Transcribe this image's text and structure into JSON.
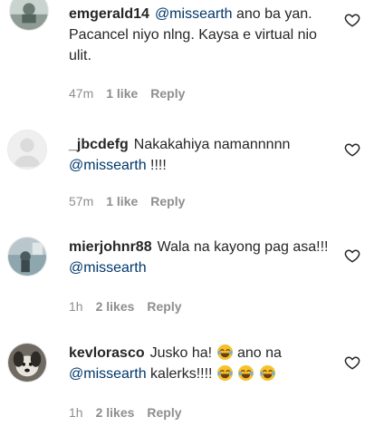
{
  "comments": [
    {
      "username": "emgerald14",
      "mention": "@missearth",
      "text_after": " ano ba yan. Pacancel niyo nlng. Kaysa e virtual nio ulit.",
      "time": "47m",
      "likes": "1 like",
      "reply": "Reply",
      "avatar_icon": "photo-avatar-icon"
    },
    {
      "username": "_jbcdefg",
      "text_before": "Nakakahiya namannnnn ",
      "mention": "@missearth",
      "text_after": " !!!!",
      "time": "57m",
      "likes": "1 like",
      "reply": "Reply",
      "avatar_icon": "default-avatar-icon"
    },
    {
      "username": "mierjohnr88",
      "text_before": "Wala na kayong pag asa!!! ",
      "mention": "@missearth",
      "time": "1h",
      "likes": "2 likes",
      "reply": "Reply",
      "avatar_icon": "photo-avatar-icon"
    },
    {
      "username": "kevlorasco",
      "text_before": "Jusko ha! ",
      "text_mid": " ano na ",
      "mention": "@missearth",
      "text_after": " kalerks!!!! ",
      "emoji": "tears-of-joy-emoji",
      "time": "1h",
      "likes": "2 likes",
      "reply": "Reply",
      "avatar_icon": "dog-photo-avatar-icon"
    }
  ],
  "colors": {
    "text": "#262626",
    "secondary": "#8e8e8e",
    "mention": "#00376b",
    "emoji_face": "#f7c12b"
  }
}
